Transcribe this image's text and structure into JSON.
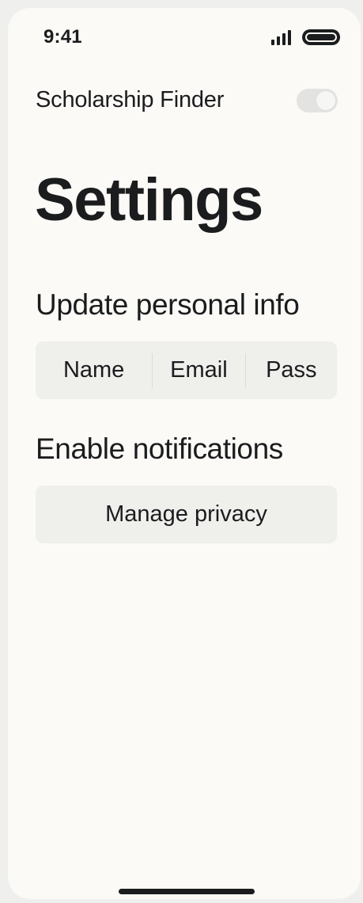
{
  "status_bar": {
    "time": "9:41"
  },
  "header": {
    "app_title": "Scholarship Finder",
    "toggle_on": true
  },
  "page_title": "Settings",
  "personal_info": {
    "title": "Update personal info",
    "segments": [
      "Name",
      "Email",
      "Pass"
    ]
  },
  "notifications": {
    "title": "Enable notifications",
    "button_label": "Manage privacy"
  },
  "icons": {
    "signal": "signal-icon",
    "battery": "battery-icon"
  },
  "colors": {
    "background": "#fbfaf6",
    "text": "#1b1c1e",
    "control_fill": "#efefec"
  }
}
